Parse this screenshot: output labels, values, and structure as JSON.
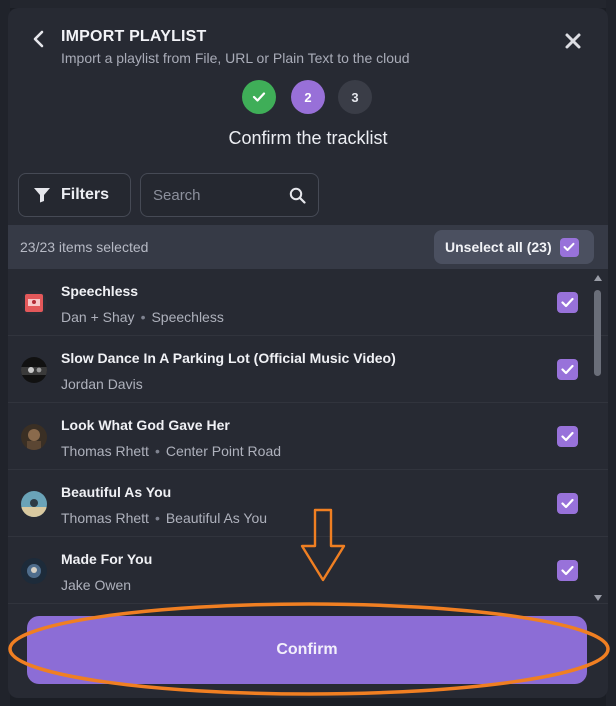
{
  "header": {
    "title": "IMPORT PLAYLIST",
    "subtitle": "Import a playlist from File, URL or Plain Text to the cloud"
  },
  "steps": [
    {
      "label": "",
      "state": "done"
    },
    {
      "label": "2",
      "state": "active"
    },
    {
      "label": "3",
      "state": "todo"
    }
  ],
  "section_title": "Confirm the tracklist",
  "toolbar": {
    "filters_label": "Filters",
    "search_placeholder": "Search"
  },
  "selection": {
    "count_text": "23/23 items selected",
    "unselect_label": "Unselect all (23)",
    "all_checked": true
  },
  "tracks": [
    {
      "title": "Speechless",
      "artist": "Dan + Shay",
      "album": "Speechless",
      "checked": true
    },
    {
      "title": "Slow Dance In A Parking Lot (Official Music Video)",
      "artist": "Jordan Davis",
      "album": "",
      "checked": true
    },
    {
      "title": "Look What God Gave Her",
      "artist": "Thomas Rhett",
      "album": "Center Point Road",
      "checked": true
    },
    {
      "title": "Beautiful As You",
      "artist": "Thomas Rhett",
      "album": "Beautiful As You",
      "checked": true
    },
    {
      "title": "Made For You",
      "artist": "Jake Owen",
      "album": "",
      "checked": true
    }
  ],
  "confirm_label": "Confirm",
  "colors": {
    "accent": "#9870d8",
    "confirm": "#8c6dd6",
    "success": "#3fae58",
    "annotation": "#f07f22"
  },
  "icons": {
    "back": "chevron-left-icon",
    "close": "close-icon",
    "filter": "funnel-icon",
    "search": "search-icon",
    "check": "checkmark-icon"
  }
}
